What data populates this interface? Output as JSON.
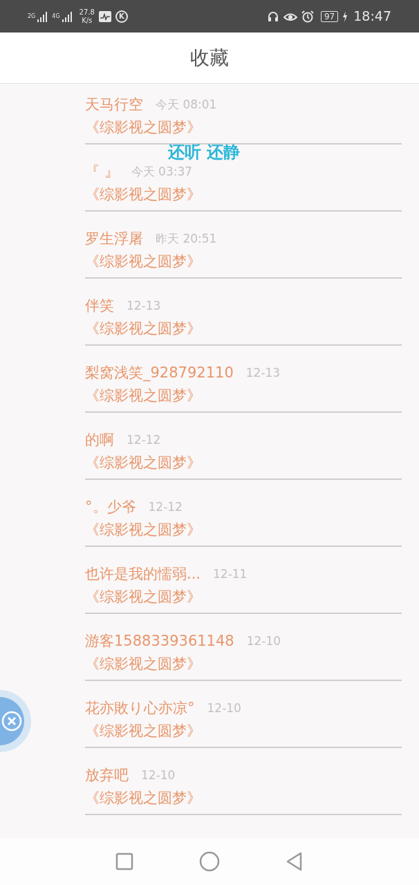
{
  "status_bar": {
    "networks": [
      "2G",
      "4G"
    ],
    "speed": [
      "27.8",
      "K/s"
    ],
    "app_badge": "K",
    "battery": "97",
    "charging": true,
    "time": "18:47"
  },
  "header": {
    "title": "收藏"
  },
  "favorites": [
    {
      "name": "天马行空",
      "time": "今天 08:01",
      "book": "《综影视之圆梦》"
    },
    {
      "name": "『 』",
      "time": "今天 03:37",
      "book": "《综影视之圆梦》"
    },
    {
      "name": "罗生浮屠",
      "time": "昨天 20:51",
      "book": "《综影视之圆梦》"
    },
    {
      "name": "伴笑",
      "time": "12-13",
      "book": "《综影视之圆梦》"
    },
    {
      "name": "梨窝浅笑_928792110",
      "time": "12-13",
      "book": "《综影视之圆梦》"
    },
    {
      "name": "的啊",
      "time": "12-12",
      "book": "《综影视之圆梦》"
    },
    {
      "name": "°。少爷",
      "time": "12-12",
      "book": "《综影视之圆梦》"
    },
    {
      "name": "也许是我的懦弱...",
      "time": "12-11",
      "book": "《综影视之圆梦》"
    },
    {
      "name": "游客1588339361148",
      "time": "12-10",
      "book": "《综影视之圆梦》"
    },
    {
      "name": "花亦敗り心亦凉°",
      "time": "12-10",
      "book": "《综影视之圆梦》"
    },
    {
      "name": "放弃吧",
      "time": "12-10",
      "book": "《综影视之圆梦》"
    }
  ],
  "overlay_lyric": "还听 还静"
}
